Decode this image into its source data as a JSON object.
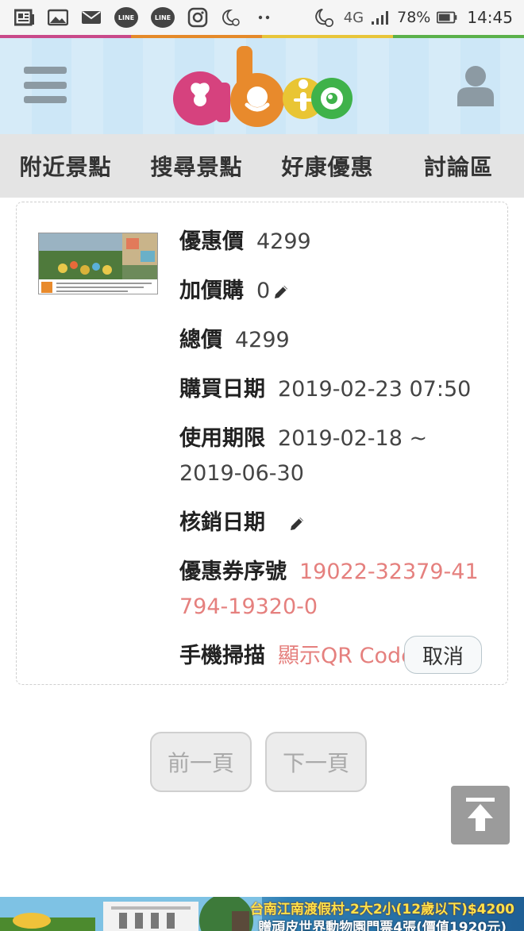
{
  "status_bar": {
    "network": "4G",
    "battery": "78%",
    "time": "14:45"
  },
  "header": {
    "logo_text": "abic"
  },
  "nav": {
    "items": [
      "附近景點",
      "搜尋景點",
      "好康優惠",
      "討論區"
    ]
  },
  "order": {
    "rows": [
      {
        "label": "優惠價",
        "value": "4299"
      },
      {
        "label": "加價購",
        "value": "0"
      },
      {
        "label": "總價",
        "value": "4299"
      },
      {
        "label": "購買日期",
        "value": "2019-02-23 07:50"
      },
      {
        "label": "使用期限",
        "value": "2019-02-18 ~ 2019-06-30"
      },
      {
        "label": "核銷日期",
        "value": ""
      },
      {
        "label": "優惠券序號",
        "value": "19022-32379-41794-19320-0"
      },
      {
        "label": "手機掃描",
        "value": "顯示QR Code"
      }
    ],
    "cancel_label": "取消"
  },
  "pager": {
    "prev_label": "前一頁",
    "next_label": "下一頁"
  },
  "banner": {
    "line1": "台南江南渡假村-2大2小(12歲以下)$4200",
    "line2": "贈頑皮世界動物園門票4張(價值1920元)"
  },
  "colors": {
    "accent_red": "#e5807e",
    "header_bg": "#cde7f7",
    "nav_bg": "#e4e4e4"
  }
}
